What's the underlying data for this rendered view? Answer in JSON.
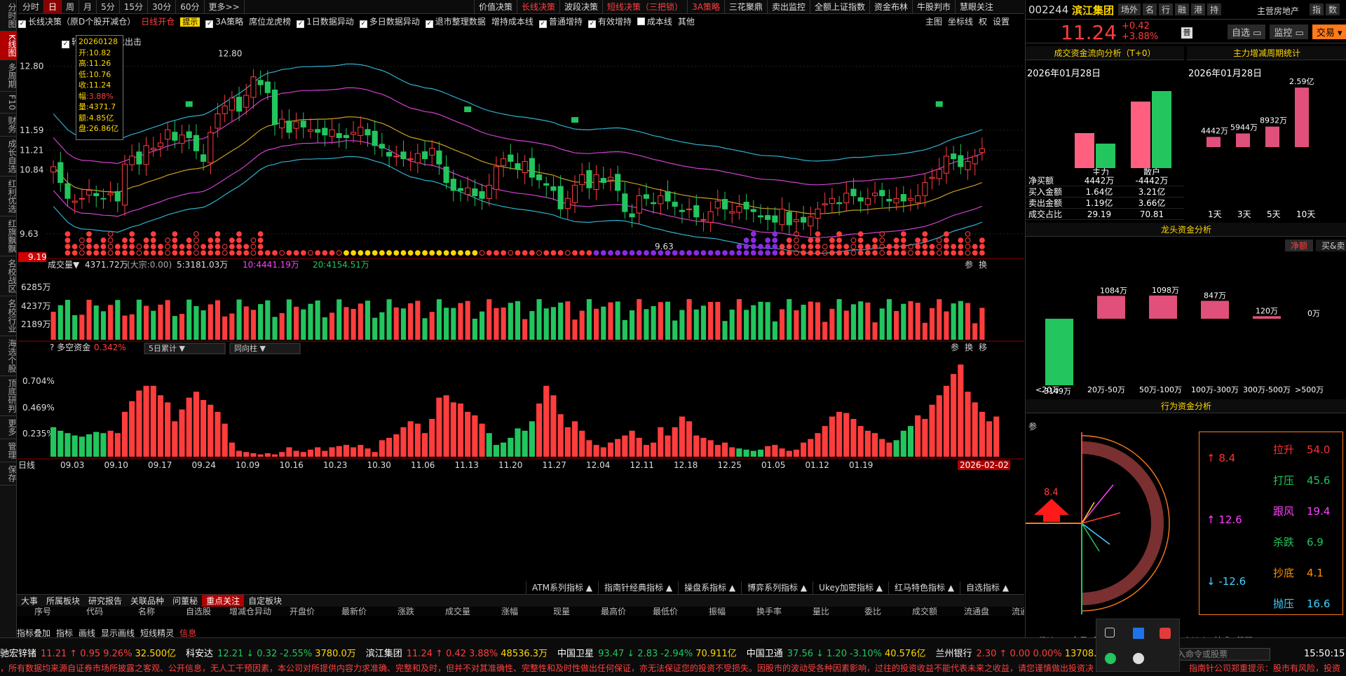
{
  "left_nav": [
    "分时图",
    "K线图",
    "多周期",
    "F10",
    "财务",
    "成长自选",
    "红利优选",
    "红旗飘飘",
    "名校战区",
    "名校行业",
    "海选个股",
    "顶底研判",
    "更多",
    "管理",
    "保存"
  ],
  "top_tabs": [
    "分时",
    "日",
    "周",
    "月",
    "5分",
    "15分",
    "30分",
    "60分",
    "更多>>"
  ],
  "top_tab_active": 1,
  "strategy_tabs": [
    "价值决策",
    "长线决策",
    "波段决策",
    "短线决策（三把锁）",
    "3A策略",
    "三花聚鼎",
    "卖出监控",
    "全额上证指数",
    "资金布林",
    "牛股判市",
    "慧眼关注"
  ],
  "strategy_active": [
    1,
    3,
    4
  ],
  "tool_row": [
    {
      "label": "长线决策（原D个股开减仓）",
      "checked": true
    },
    {
      "label": "日线开仓",
      "color": "red"
    },
    {
      "label": "提示",
      "color": "yellow"
    },
    {
      "label": "3A策略",
      "checked": true
    },
    {
      "label": "席位龙虎榜"
    },
    {
      "label": "1日数据异动",
      "checked": true
    },
    {
      "label": "多日数据异动",
      "checked": true
    },
    {
      "label": "退市整理数据",
      "checked": true
    },
    {
      "label": "增持成本线"
    },
    {
      "label": "普通增持",
      "checked": true
    },
    {
      "label": "有效增持",
      "checked": true
    },
    {
      "label": "成本线",
      "checked": false
    },
    {
      "label": "其他"
    }
  ],
  "tool_row_right": [
    "主图",
    "坐标线",
    "权",
    "设置"
  ],
  "tool_row2": [
    {
      "label": "轮动",
      "checked": true
    },
    {
      "label": "擒龙出击",
      "checked": true
    }
  ],
  "info_box": {
    "date": "20260128",
    "open": "10.82",
    "high": "11.26",
    "low": "10.76",
    "close": "11.24",
    "amp": "3.88%",
    "vol": "4371.7",
    "amt": "4.85亿",
    "pan": "26.86亿",
    "labels": [
      "开",
      "高",
      "低",
      "收",
      "幅",
      "量",
      "额",
      "盘"
    ]
  },
  "price_axis": [
    "12.80",
    "11.59",
    "11.21",
    "10.84",
    "9.63"
  ],
  "price_marker": "9.19",
  "hi_label": "12.80",
  "lo_label": "9.63",
  "volume": {
    "title": "成交量",
    "value": "4371.72万",
    "extra": "(大宗:0.00)",
    "ma5": "5:3181.03万",
    "ma10": "10:4441.19万",
    "ma20": "20:4154.51万",
    "axis": [
      "6285万",
      "4237万",
      "2189万"
    ],
    "tools": [
      "参",
      "换"
    ]
  },
  "money": {
    "title": "多空资金",
    "value": "0.342%",
    "dd1": "5日累计",
    "dd2": "同向柱",
    "axis": [
      "0.704%",
      "0.469%",
      "0.235%"
    ],
    "tools": [
      "参",
      "换",
      "移"
    ]
  },
  "x_axis": {
    "period": "日线",
    "dates": [
      "09.03",
      "09.10",
      "09.17",
      "09.24",
      "10.09",
      "10.16",
      "10.23",
      "10.30",
      "11.06",
      "11.13",
      "11.20",
      "11.27",
      "12.04",
      "12.11",
      "12.18",
      "12.25",
      "01.05",
      "01.12",
      "01.19"
    ],
    "current": "2026-02-02"
  },
  "indicator_tabs": [
    "ATM系列指标",
    "指南针经典指标",
    "操盘系指标",
    "博弈系列指标",
    "Ukey加密指标",
    "红马特色指标",
    "自选指标"
  ],
  "bottom_tabs": [
    "大事",
    "所属板块",
    "研究报告",
    "关联品种",
    "问董秘",
    "重点关注",
    "自定板块"
  ],
  "bottom_tab_active": 5,
  "table_cols": [
    "序号",
    "代码",
    "名称",
    "自选股",
    "增减仓异动",
    "开盘价",
    "最新价",
    "涨跌",
    "成交量",
    "涨幅",
    "现量",
    "最高价",
    "最低价",
    "振幅",
    "换手率",
    "量比",
    "委比",
    "成交额",
    "流通盘",
    "流通市值"
  ],
  "draw_bar": [
    "指标叠加",
    "指标",
    "画线",
    "显示画线",
    "短线精灵",
    "信息"
  ],
  "stock": {
    "code": "002244",
    "name": "滨江集团",
    "price": "11.24",
    "chg": "+0.42",
    "pct": "+3.88%",
    "sector": "主营房地产",
    "btns": [
      "场外",
      "名",
      "行",
      "融",
      "港",
      "持"
    ],
    "right_btns": [
      "指",
      "数"
    ],
    "actions": [
      "自选",
      "监控",
      "交易"
    ]
  },
  "flow": {
    "title": "成交资金流向分析（T+0）",
    "date": "2026年01月28日",
    "cats": [
      "主力",
      "散户"
    ],
    "rows": [
      [
        "净买额",
        "4442万",
        "-4442万"
      ],
      [
        "买入金额",
        "1.64亿",
        "3.21亿"
      ],
      [
        "卖出金额",
        "1.19亿",
        "3.66亿"
      ],
      [
        "成交占比",
        "29.19",
        "70.81"
      ]
    ]
  },
  "cycle": {
    "title": "主力增减周期统计",
    "date": "2026年01月28日",
    "labels": [
      "1天",
      "3天",
      "5天",
      "10天"
    ],
    "values": [
      "4442万",
      "5944万",
      "8932万",
      "2.59亿"
    ],
    "nums": [
      4442,
      5944,
      8932,
      25900
    ]
  },
  "dragon": {
    "title": "龙头资金分析",
    "tabs": [
      "净额",
      "买&卖"
    ],
    "labels": [
      "<20万",
      "20万-50万",
      "50万-100万",
      "100万-300万",
      "300万-500万",
      ">500万"
    ],
    "values": [
      "-3149万",
      "1084万",
      "1098万",
      "847万",
      "120万",
      "0万"
    ],
    "nums": [
      -3149,
      1084,
      1098,
      847,
      120,
      0
    ]
  },
  "behavior": {
    "title": "行为资金分析",
    "arrow_val": "8.4",
    "left": [
      {
        "v": "8.4",
        "c": "#ff3030",
        "a": "↑"
      },
      {
        "v": "12.6",
        "c": "#ff40ff",
        "a": "↑"
      },
      {
        "v": "-12.6",
        "c": "#40d0ff",
        "a": "↓"
      }
    ],
    "right": [
      {
        "k": "拉升",
        "v": "54.0",
        "c": "#ff3030"
      },
      {
        "k": "打压",
        "v": "45.6",
        "c": "#22c55e"
      },
      {
        "k": "跟风",
        "v": "19.4",
        "c": "#ff40ff"
      },
      {
        "k": "杀跌",
        "v": "6.9",
        "c": "#22c55e"
      },
      {
        "k": "抄底",
        "v": "4.1",
        "c": "#ff9000"
      },
      {
        "k": "抛压",
        "v": "16.6",
        "c": "#40d0ff"
      }
    ]
  },
  "right_bottom_tabs": [
    "L2极速",
    "L2全景",
    "财",
    "仓位",
    "三榜",
    "晴雨",
    "资金流向",
    "技术",
    "筹码"
  ],
  "tickers": [
    {
      "name": "驰宏锌锗",
      "price": "11.21",
      "chg": "0.95",
      "pct": "9.26%",
      "amt": "32.500亿",
      "up": true
    },
    {
      "name": "科安达",
      "price": "12.21",
      "chg": "0.32",
      "pct": "-2.55%",
      "amt": "3780.0万",
      "up": false
    },
    {
      "name": "滨江集团",
      "price": "11.24",
      "chg": "0.42",
      "pct": "3.88%",
      "amt": "48536.3万",
      "up": true
    },
    {
      "name": "中国卫星",
      "price": "93.47",
      "chg": "2.83",
      "pct": "-2.94%",
      "amt": "70.911亿",
      "up": false
    },
    {
      "name": "中国卫通",
      "price": "37.56",
      "chg": "1.20",
      "pct": "-3.10%",
      "amt": "40.576亿",
      "up": false
    },
    {
      "name": "兰州银行",
      "price": "2.30",
      "chg": "0.00",
      "pct": "0.00%",
      "amt": "13708.6万",
      "up": true
    }
  ],
  "command_placeholder": "输入命令或股票",
  "clock": "15:50:15",
  "disclaimer": "，所有数据均来源自证券市场所披露之客观、公开信息，无人工干预因素，本公司对所提供内容力求准确、完整和及时，但并不对其准确性、完整性和及时性做出任何保证，亦无法保证您的投资不受损失。因股市的波动受各种因素影响，过往的投资收益不能代表未来之收益，请您谨慎做出投资决",
  "disclaimer_right": "指南针公司郑重提示：股市有风险，投资",
  "chart_data": {
    "type": "candlestick",
    "title": "滨江集团 日线",
    "x_dates": [
      "09.03",
      "09.10",
      "09.17",
      "09.24",
      "10.09",
      "10.16",
      "10.23",
      "10.30",
      "11.06",
      "11.13",
      "11.20",
      "11.27",
      "12.04",
      "12.11",
      "12.18",
      "12.25",
      "01.05",
      "01.12",
      "01.19",
      "2026-02-02"
    ],
    "ylim": [
      9.19,
      13.1
    ],
    "closes": [
      10.9,
      10.6,
      10.3,
      10.25,
      10.3,
      10.45,
      10.35,
      10.3,
      10.4,
      10.25,
      10.95,
      11.1,
      10.95,
      11.3,
      11.25,
      11.35,
      11.6,
      11.4,
      11.5,
      11.45,
      11.2,
      11.0,
      11.55,
      11.9,
      12.05,
      12.2,
      11.95,
      12.25,
      12.6,
      12.45,
      12.3,
      11.7,
      11.8,
      11.55,
      11.75,
      11.65,
      11.6,
      11.55,
      11.5,
      11.6,
      11.45,
      11.45,
      11.55,
      11.65,
      11.5,
      11.3,
      11.25,
      11.1,
      11.1,
      11.05,
      11.05,
      11.15,
      11.05,
      11.25,
      10.95,
      10.6,
      10.45,
      10.45,
      10.5,
      10.35,
      10.3,
      10.55,
      10.9,
      11.05,
      11.0,
      10.85,
      11.0,
      10.7,
      10.65,
      10.55,
      10.45,
      10.1,
      10.3,
      10.55,
      10.75,
      10.5,
      10.75,
      10.6,
      10.7,
      10.45,
      10.05,
      9.95,
      10.35,
      10.3,
      10.2,
      10.35,
      10.25,
      10.15,
      10.05,
      10.1,
      9.95,
      9.9,
      10.05,
      10.25,
      10.1,
      10.05,
      10.15,
      10.1,
      10.05,
      9.95,
      9.9,
      9.85,
      10.1,
      9.8,
      9.9,
      9.85,
      9.95,
      10.1,
      10.2,
      10.3,
      10.2,
      10.4,
      10.35,
      10.25,
      10.3,
      10.4,
      10.35,
      10.25,
      10.3,
      10.25,
      10.3,
      10.35,
      10.6,
      10.7,
      10.85,
      11.1,
      11.05,
      10.9,
      11.0,
      11.1,
      11.24
    ],
    "volume_axis": [
      "6285万",
      "4237万",
      "2189万"
    ],
    "money_axis": [
      "0.704%",
      "0.469%",
      "0.235%"
    ],
    "money_values": [
      0.25,
      0.22,
      0.2,
      0.18,
      0.17,
      0.19,
      0.21,
      0.2,
      0.22,
      0.2,
      0.38,
      0.47,
      0.56,
      0.6,
      0.6,
      0.52,
      0.46,
      0.3,
      0.4,
      0.5,
      0.55,
      0.48,
      0.44,
      0.38,
      0.28,
      0.12,
      0.05,
      0.04,
      0.03,
      0.02,
      0.03,
      0.02,
      0.04,
      0.08,
      0.05,
      0.04,
      0.06,
      0.08,
      0.05,
      0.08,
      0.09,
      0.1,
      0.08,
      0.1,
      0.07,
      0.04,
      0.14,
      0.16,
      0.19,
      0.25,
      0.3,
      0.28,
      0.2,
      0.32,
      0.5,
      0.52,
      0.46,
      0.45,
      0.38,
      0.35,
      0.28,
      0.2,
      0.1,
      0.12,
      0.16,
      0.24,
      0.22,
      0.3,
      0.45,
      0.6,
      0.52,
      0.36,
      0.25,
      0.3,
      0.22,
      0.14,
      0.1,
      0.08,
      0.12,
      0.15,
      0.18,
      0.22,
      0.16,
      0.1,
      0.12,
      0.25,
      0.18,
      0.25,
      0.34,
      0.3,
      0.18,
      0.16,
      0.14,
      0.1,
      0.12,
      0.08,
      0.07,
      0.06,
      0.05,
      0.06,
      0.09,
      0.1,
      0.07,
      0.05,
      0.06,
      0.12,
      0.15,
      0.2,
      0.26,
      0.34,
      0.38,
      0.37,
      0.32,
      0.26,
      0.22,
      0.2,
      0.15,
      0.12,
      0.14,
      0.22,
      0.26,
      0.35,
      0.32,
      0.44,
      0.52,
      0.6,
      0.7,
      0.78,
      0.55,
      0.46,
      0.38,
      0.3,
      0.34
    ]
  }
}
